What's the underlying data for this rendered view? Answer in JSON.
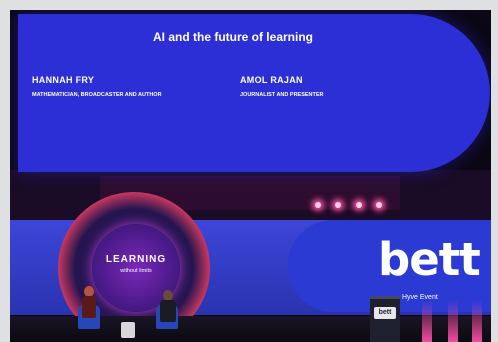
{
  "screen": {
    "title": "AI and the future of learning",
    "speakers": [
      {
        "name": "HANNAH FRY",
        "role": "MATHEMATICIAN, BROADCASTER AND AUTHOR"
      },
      {
        "name": "AMOL RAJAN",
        "role": "JOURNALIST AND PRESENTER"
      }
    ]
  },
  "stage_sign": {
    "title": "LEARNING",
    "subtitle": "without limits"
  },
  "brand": {
    "logo": "bett",
    "tagline": "Hyve Event",
    "podium_logo": "bett"
  },
  "colors": {
    "screen_blue": "#2d2fd6",
    "neon_pink": "#f14b76",
    "stage_purple": "#4b1a8a"
  }
}
